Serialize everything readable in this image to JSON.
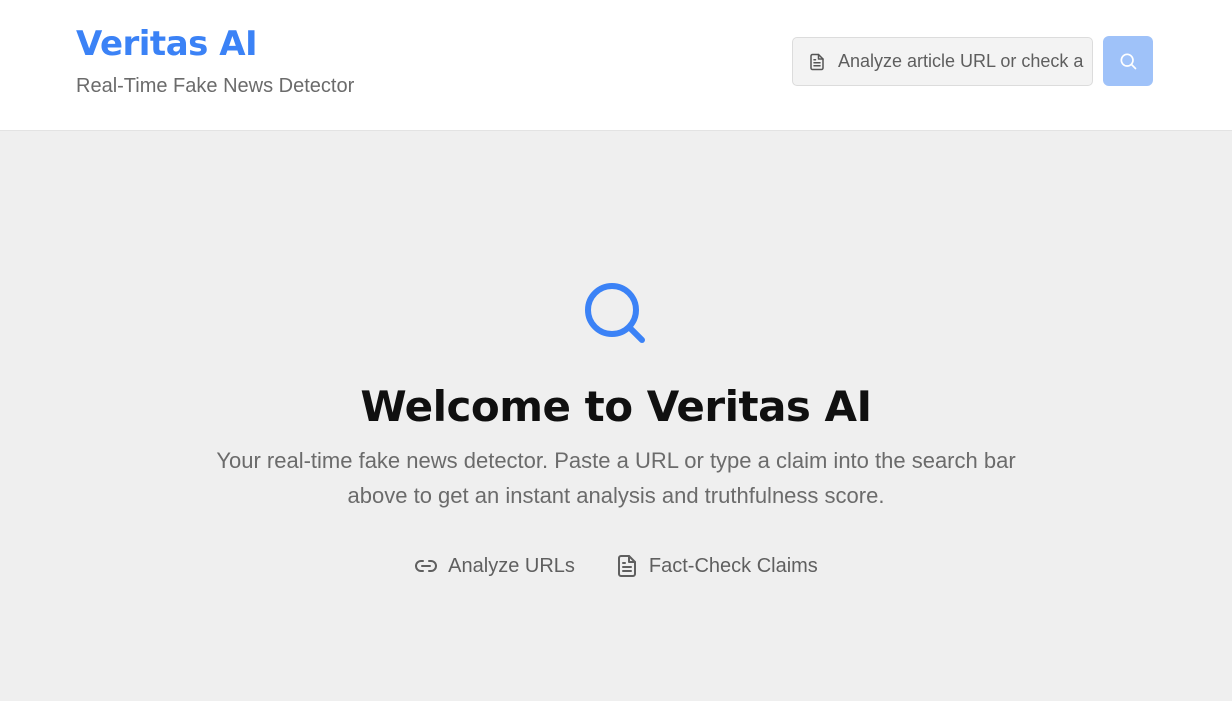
{
  "header": {
    "title": "Veritas AI",
    "subtitle": "Real-Time Fake News Detector"
  },
  "search": {
    "placeholder": "Analyze article URL or check a claim",
    "value": "",
    "icon": "document-icon",
    "button_icon": "search-icon"
  },
  "hero": {
    "icon": "search-icon",
    "title": "Welcome to Veritas AI",
    "description": "Your real-time fake news detector. Paste a URL or type a claim into the search bar above to get an instant analysis and truthfulness score.",
    "features": [
      {
        "icon": "link-icon",
        "label": "Analyze URLs"
      },
      {
        "icon": "document-icon",
        "label": "Fact-Check Claims"
      }
    ]
  },
  "colors": {
    "accent": "#3b82f6",
    "button": "#9fc2f9",
    "background": "#efefef",
    "header_bg": "#ffffff"
  }
}
